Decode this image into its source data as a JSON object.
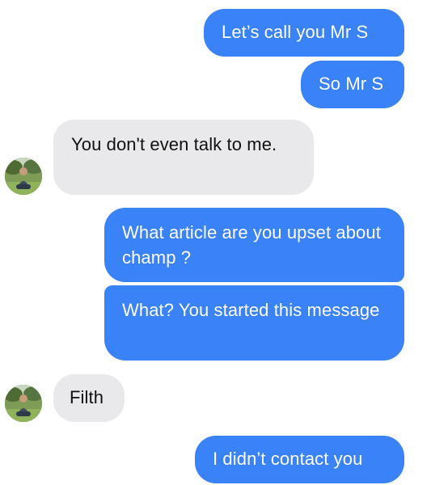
{
  "messages": [
    {
      "direction": "outgoing",
      "text": "Let’s call you Mr S"
    },
    {
      "direction": "outgoing",
      "text": "So Mr S"
    },
    {
      "direction": "incoming",
      "text": "You don't even talk to me."
    },
    {
      "direction": "outgoing",
      "text": "What article are you upset about champ ?"
    },
    {
      "direction": "outgoing",
      "text": "What? You started this message"
    },
    {
      "direction": "incoming",
      "text": "Filth"
    },
    {
      "direction": "outgoing",
      "text": "I didn’t contact you"
    }
  ],
  "colors": {
    "outgoing_bubble": "#3a82f7",
    "incoming_bubble": "#e9e9eb",
    "background": "#ffffff"
  }
}
